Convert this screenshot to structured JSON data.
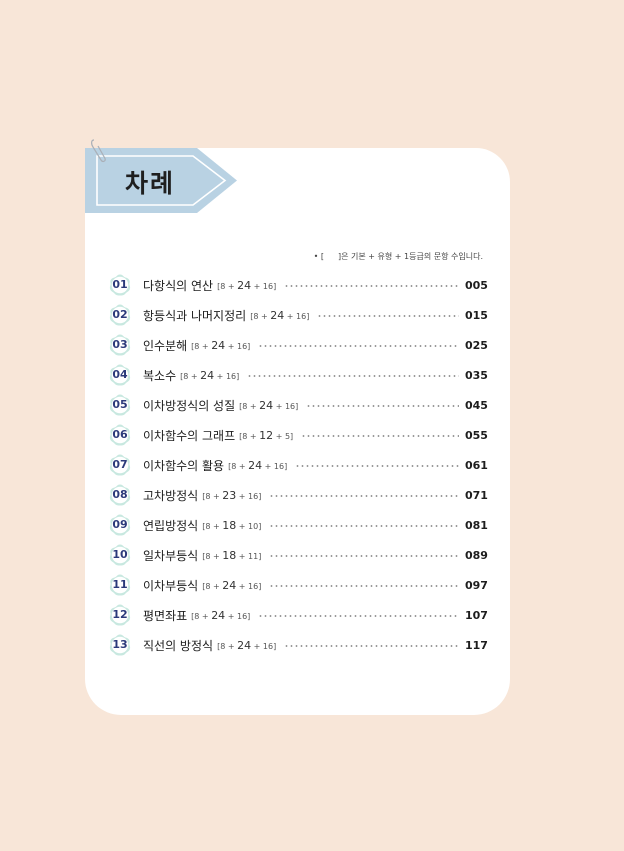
{
  "header": {
    "title": "차례"
  },
  "note": {
    "prefix": "• [",
    "text": "]은 기본 + 유형 + 1등급의 문항 수입니다."
  },
  "toc": [
    {
      "num": "01",
      "title": "다항식의 연산",
      "r1": "8",
      "r2": "24",
      "r3": "16",
      "page": "005"
    },
    {
      "num": "02",
      "title": "항등식과 나머지정리",
      "r1": "8",
      "r2": "24",
      "r3": "16",
      "page": "015"
    },
    {
      "num": "03",
      "title": "인수분해",
      "r1": "8",
      "r2": "24",
      "r3": "16",
      "page": "025"
    },
    {
      "num": "04",
      "title": "복소수",
      "r1": "8",
      "r2": "24",
      "r3": "16",
      "page": "035"
    },
    {
      "num": "05",
      "title": "이차방정식의 성질",
      "r1": "8",
      "r2": "24",
      "r3": "16",
      "page": "045"
    },
    {
      "num": "06",
      "title": "이차함수의 그래프",
      "r1": "8",
      "r2": "12",
      "r3": "5",
      "page": "055"
    },
    {
      "num": "07",
      "title": "이차함수의 활용",
      "r1": "8",
      "r2": "24",
      "r3": "16",
      "page": "061"
    },
    {
      "num": "08",
      "title": "고차방정식",
      "r1": "8",
      "r2": "23",
      "r3": "16",
      "page": "071"
    },
    {
      "num": "09",
      "title": "연립방정식",
      "r1": "8",
      "r2": "18",
      "r3": "10",
      "page": "081"
    },
    {
      "num": "10",
      "title": "일차부등식",
      "r1": "8",
      "r2": "18",
      "r3": "11",
      "page": "089"
    },
    {
      "num": "11",
      "title": "이차부등식",
      "r1": "8",
      "r2": "24",
      "r3": "16",
      "page": "097"
    },
    {
      "num": "12",
      "title": "평면좌표",
      "r1": "8",
      "r2": "24",
      "r3": "16",
      "page": "107"
    },
    {
      "num": "13",
      "title": "직선의 방정식",
      "r1": "8",
      "r2": "24",
      "r3": "16",
      "page": "117"
    }
  ]
}
